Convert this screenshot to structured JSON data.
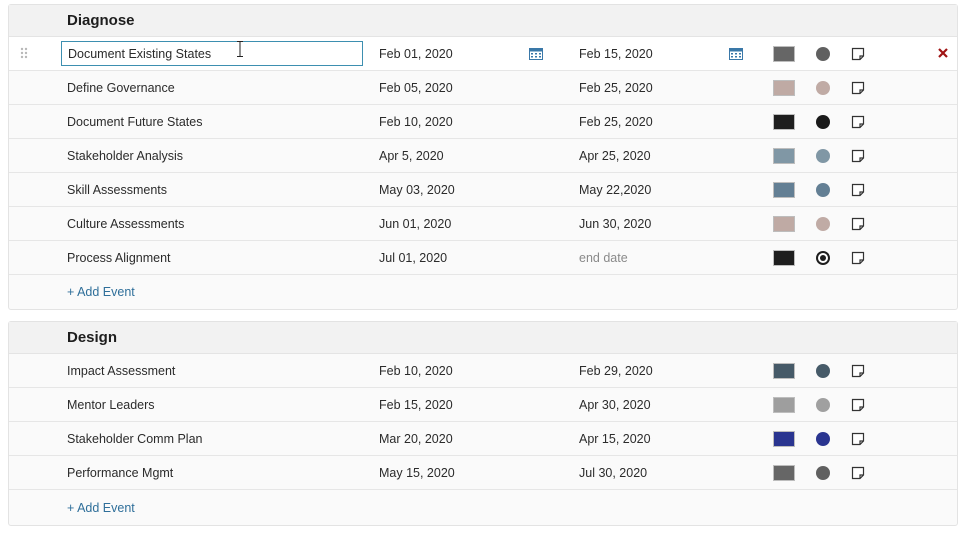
{
  "colors": {
    "accent": "#2f6f9a",
    "input_border": "#3d8fb0",
    "delete": "#a01414",
    "calendar": "#3a78a8"
  },
  "groups": [
    {
      "title": "Diagnose",
      "add_event_label": "+ Add Event",
      "rows": [
        {
          "name": "Document Existing States",
          "start": "Feb 01, 2020",
          "end": "Feb 15, 2020",
          "color": "#666666",
          "dot_color": "#606060"
        },
        {
          "name": "Define Governance",
          "start": "Feb 05, 2020",
          "end": "Feb 25, 2020",
          "color": "#bfaaa4",
          "dot_color": "#c0aba5"
        },
        {
          "name": "Document Future States",
          "start": "Feb 10, 2020",
          "end": "Feb 25, 2020",
          "color": "#1e1e1e",
          "dot_color": "#1a1a1a"
        },
        {
          "name": "Stakeholder Analysis",
          "start": "Apr 5, 2020",
          "end": "Apr 25, 2020",
          "color": "#8097a5",
          "dot_color": "#8097a5"
        },
        {
          "name": "Skill Assessments",
          "start": "May 03, 2020",
          "end": "May 22,2020",
          "color": "#637f94",
          "dot_color": "#637f94"
        },
        {
          "name": "Culture Assessments",
          "start": "Jun 01, 2020",
          "end": "Jun 30, 2020",
          "color": "#bfaaa4",
          "dot_color": "#c0aba5"
        },
        {
          "name": "Process Alignment",
          "start": "Jul 01, 2020",
          "end_placeholder": "end date",
          "color": "#1e1e1e",
          "dot_style": "ring"
        }
      ]
    },
    {
      "title": "Design",
      "add_event_label": "+ Add Event",
      "rows": [
        {
          "name": "Impact Assessment",
          "start": "Feb 10, 2020",
          "end": "Feb 29, 2020",
          "color": "#465a68",
          "dot_color": "#465a68"
        },
        {
          "name": "Mentor Leaders",
          "start": "Feb 15, 2020",
          "end": "Apr 30, 2020",
          "color": "#9e9e9e",
          "dot_color": "#a0a0a0"
        },
        {
          "name": "Stakeholder Comm Plan",
          "start": "Mar 20, 2020",
          "end": "Apr 15, 2020",
          "color": "#2a3590",
          "dot_color": "#2a3590"
        },
        {
          "name": "Performance Mgmt",
          "start": "May 15, 2020",
          "end": "Jul 30, 2020",
          "color": "#666666",
          "dot_color": "#606060"
        }
      ]
    }
  ]
}
